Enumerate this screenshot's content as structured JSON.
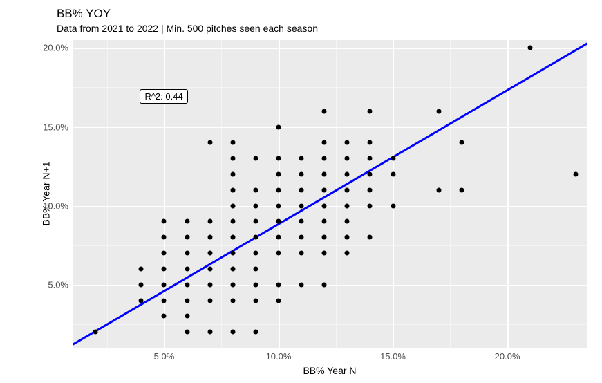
{
  "chart_data": {
    "type": "scatter",
    "title": "BB% YOY",
    "subtitle": "Data from 2021 to 2022 | Min. 500 pitches seen each season",
    "xlabel": "BB% Year N",
    "ylabel": "BB% Year N+1",
    "xlim": [
      1.0,
      23.5
    ],
    "ylim": [
      1.0,
      20.5
    ],
    "xticks": [
      5.0,
      10.0,
      15.0,
      20.0
    ],
    "yticks": [
      5.0,
      10.0,
      15.0,
      20.0
    ],
    "xtick_labels": [
      "5.0%",
      "10.0%",
      "15.0%",
      "20.0%"
    ],
    "ytick_labels": [
      "5.0%",
      "10.0%",
      "15.0%",
      "20.0%"
    ],
    "annotation": "R^2: 0.44",
    "annotation_xy": [
      5.0,
      17.0
    ],
    "regression": {
      "x1": 1.0,
      "y1": 1.2,
      "x2": 23.5,
      "y2": 20.3
    },
    "points": [
      [
        2,
        2
      ],
      [
        4,
        4
      ],
      [
        4,
        5
      ],
      [
        4,
        6
      ],
      [
        5,
        3
      ],
      [
        5,
        4
      ],
      [
        5,
        5
      ],
      [
        5,
        6
      ],
      [
        5,
        7
      ],
      [
        5,
        8
      ],
      [
        5,
        9
      ],
      [
        6,
        2
      ],
      [
        6,
        3
      ],
      [
        6,
        4
      ],
      [
        6,
        5
      ],
      [
        6,
        6
      ],
      [
        6,
        7
      ],
      [
        6,
        8
      ],
      [
        6,
        9
      ],
      [
        7,
        2
      ],
      [
        7,
        4
      ],
      [
        7,
        5
      ],
      [
        7,
        6
      ],
      [
        7,
        7
      ],
      [
        7,
        8
      ],
      [
        7,
        9
      ],
      [
        7,
        14
      ],
      [
        8,
        2
      ],
      [
        8,
        4
      ],
      [
        8,
        5
      ],
      [
        8,
        6
      ],
      [
        8,
        7
      ],
      [
        8,
        8
      ],
      [
        8,
        9
      ],
      [
        8,
        10
      ],
      [
        8,
        11
      ],
      [
        8,
        12
      ],
      [
        8,
        13
      ],
      [
        8,
        14
      ],
      [
        9,
        2
      ],
      [
        9,
        4
      ],
      [
        9,
        5
      ],
      [
        9,
        6
      ],
      [
        9,
        7
      ],
      [
        9,
        8
      ],
      [
        9,
        9
      ],
      [
        9,
        10
      ],
      [
        9,
        11
      ],
      [
        9,
        13
      ],
      [
        10,
        4
      ],
      [
        10,
        5
      ],
      [
        10,
        7
      ],
      [
        10,
        8
      ],
      [
        10,
        9
      ],
      [
        10,
        10
      ],
      [
        10,
        11
      ],
      [
        10,
        12
      ],
      [
        10,
        13
      ],
      [
        10,
        15
      ],
      [
        11,
        5
      ],
      [
        11,
        7
      ],
      [
        11,
        8
      ],
      [
        11,
        9
      ],
      [
        11,
        10
      ],
      [
        11,
        11
      ],
      [
        11,
        12
      ],
      [
        11,
        13
      ],
      [
        12,
        5
      ],
      [
        12,
        7
      ],
      [
        12,
        8
      ],
      [
        12,
        9
      ],
      [
        12,
        10
      ],
      [
        12,
        11
      ],
      [
        12,
        12
      ],
      [
        12,
        13
      ],
      [
        12,
        14
      ],
      [
        12,
        16
      ],
      [
        13,
        7
      ],
      [
        13,
        8
      ],
      [
        13,
        9
      ],
      [
        13,
        10
      ],
      [
        13,
        11
      ],
      [
        13,
        12
      ],
      [
        13,
        13
      ],
      [
        13,
        14
      ],
      [
        14,
        8
      ],
      [
        14,
        10
      ],
      [
        14,
        11
      ],
      [
        14,
        12
      ],
      [
        14,
        13
      ],
      [
        14,
        14
      ],
      [
        14,
        16
      ],
      [
        15,
        10
      ],
      [
        15,
        12
      ],
      [
        15,
        13
      ],
      [
        17,
        11
      ],
      [
        17,
        16
      ],
      [
        18,
        11
      ],
      [
        18,
        14
      ],
      [
        21,
        20
      ],
      [
        23,
        12
      ]
    ]
  }
}
